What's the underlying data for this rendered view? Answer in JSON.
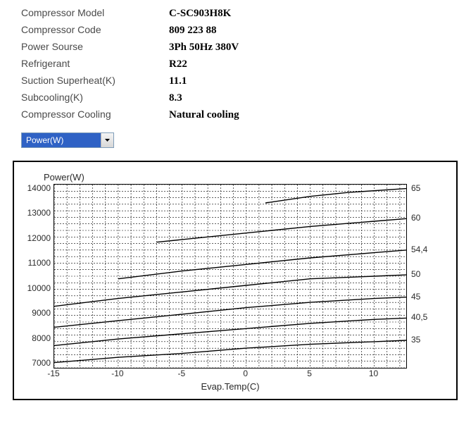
{
  "specs": {
    "rows": [
      {
        "label": "Compressor Model",
        "value": "C-SC903H8K"
      },
      {
        "label": "Compressor Code",
        "value": "809 223 88"
      },
      {
        "label": "Power Sourse",
        "value": "3Ph  50Hz  380V"
      },
      {
        "label": "Refrigerant",
        "value": "R22"
      },
      {
        "label": "Suction Superheat(K)",
        "value": "11.1"
      },
      {
        "label": "Subcooling(K)",
        "value": "8.3"
      },
      {
        "label": "Compressor Cooling",
        "value": "Natural cooling"
      }
    ]
  },
  "dropdown": {
    "selected": "Power(W)"
  },
  "chart": {
    "title": "Power(W)",
    "xlabel": "Evap.Temp(C)"
  },
  "chart_data": {
    "type": "line",
    "title": "Power(W)",
    "xlabel": "Evap.Temp(C)",
    "ylabel": "Power(W)",
    "xlim": [
      -15,
      12.5
    ],
    "ylim": [
      7000,
      14000
    ],
    "x_ticks": [
      -15,
      -10,
      -5,
      0,
      5,
      10
    ],
    "y_ticks": [
      7000,
      8000,
      9000,
      10000,
      11000,
      12000,
      13000,
      14000
    ],
    "series_labels_right": [
      "65",
      "60",
      "54,4",
      "50",
      "45",
      "40,5",
      "35"
    ],
    "series": [
      {
        "name": "65",
        "points": [
          [
            1.5,
            13300
          ],
          [
            5,
            13550
          ],
          [
            8,
            13700
          ],
          [
            12.5,
            13850
          ]
        ]
      },
      {
        "name": "60",
        "points": [
          [
            -7,
            11800
          ],
          [
            0,
            12150
          ],
          [
            5,
            12400
          ],
          [
            10,
            12600
          ],
          [
            12.5,
            12700
          ]
        ]
      },
      {
        "name": "54,4",
        "points": [
          [
            -10,
            10400
          ],
          [
            -5,
            10700
          ],
          [
            0,
            10950
          ],
          [
            5,
            11200
          ],
          [
            10,
            11400
          ],
          [
            12.5,
            11500
          ]
        ]
      },
      {
        "name": "50",
        "points": [
          [
            -15,
            9350
          ],
          [
            -10,
            9650
          ],
          [
            -5,
            9900
          ],
          [
            0,
            10150
          ],
          [
            5,
            10400
          ],
          [
            10,
            10500
          ],
          [
            12.5,
            10550
          ]
        ]
      },
      {
        "name": "45",
        "points": [
          [
            -15,
            8550
          ],
          [
            -10,
            8800
          ],
          [
            -5,
            9050
          ],
          [
            0,
            9300
          ],
          [
            5,
            9500
          ],
          [
            10,
            9650
          ],
          [
            12.5,
            9700
          ]
        ]
      },
      {
        "name": "40,5",
        "points": [
          [
            -15,
            7850
          ],
          [
            -10,
            8100
          ],
          [
            -5,
            8300
          ],
          [
            0,
            8500
          ],
          [
            5,
            8700
          ],
          [
            10,
            8850
          ],
          [
            12.5,
            8900
          ]
        ]
      },
      {
        "name": "35",
        "points": [
          [
            -15,
            7200
          ],
          [
            -10,
            7400
          ],
          [
            -5,
            7550
          ],
          [
            0,
            7750
          ],
          [
            5,
            7900
          ],
          [
            10,
            8000
          ],
          [
            12.5,
            8050
          ]
        ]
      }
    ]
  }
}
